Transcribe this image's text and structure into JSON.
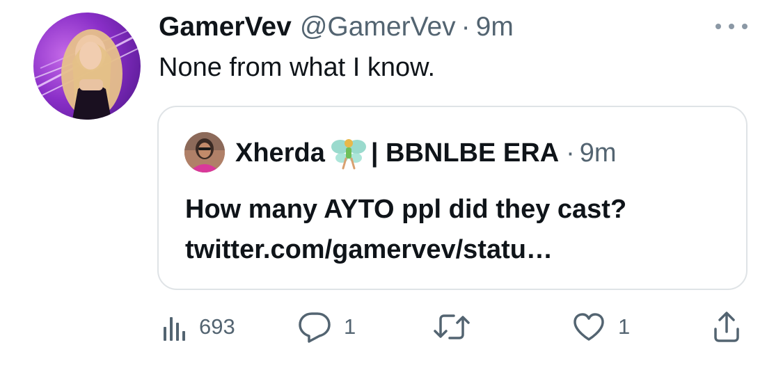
{
  "tweet": {
    "author_name": "GamerVev",
    "author_handle": "@GamerVev",
    "separator": "·",
    "time": "9m",
    "text": "None from what I know."
  },
  "quoted_tweet": {
    "author_name": "Xherda",
    "author_name_suffix": "| BBNLBE ERA",
    "separator": "·",
    "time": "9m",
    "text_line1": "How many AYTO ppl did they cast?",
    "text_line2": "twitter.com/gamervev/statu…"
  },
  "actions": {
    "views": "693",
    "replies": "1",
    "retweets": "",
    "likes": "1"
  },
  "icons": {
    "more": "more-icon",
    "views": "analytics-icon",
    "reply": "reply-icon",
    "retweet": "retweet-icon",
    "like": "heart-icon",
    "share": "share-icon",
    "emoji": "fairy-emoji"
  },
  "colors": {
    "text": "#0f1419",
    "secondary": "#536471",
    "border": "#dfe3e6",
    "avatar_purple": "#8a2fc8"
  }
}
